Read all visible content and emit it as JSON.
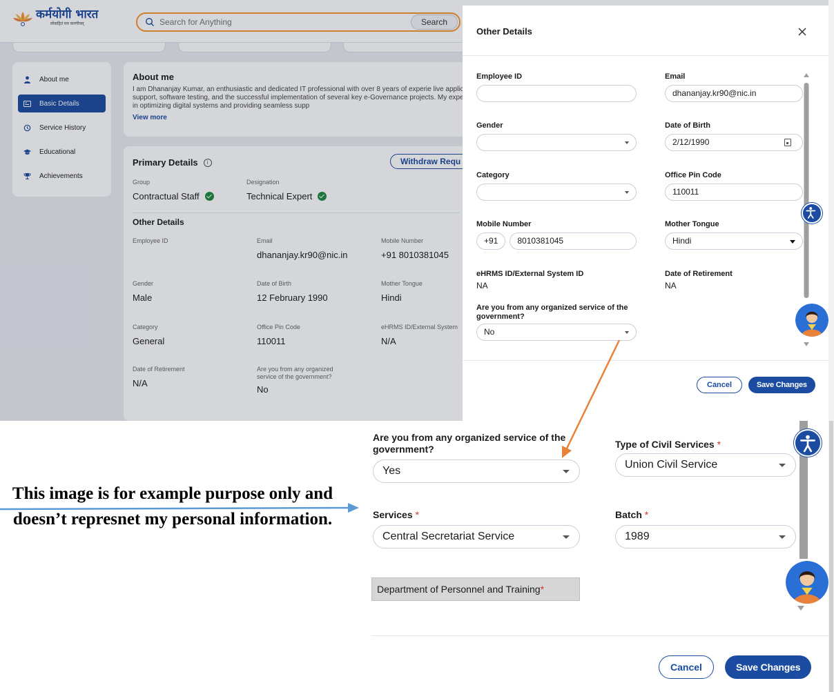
{
  "header": {
    "logo_text": "कर्मयोगी भारत",
    "logo_tagline": "लोकहितं मम करणीयम्",
    "search_placeholder": "Search for Anything",
    "search_button": "Search"
  },
  "sidebar": {
    "items": [
      {
        "label": "About me",
        "icon": "person-icon",
        "active": false
      },
      {
        "label": "Basic Details",
        "icon": "id-card-icon",
        "active": true
      },
      {
        "label": "Service History",
        "icon": "history-icon",
        "active": false
      },
      {
        "label": "Educational",
        "icon": "graduation-cap-icon",
        "active": false
      },
      {
        "label": "Achievements",
        "icon": "trophy-icon",
        "active": false
      }
    ]
  },
  "about": {
    "title": "About me",
    "text": "I am Dhananjay Kumar, an enthusiastic and dedicated IT professional with over 8 years of experie live application support, software testing, and the successful implementation of several key e-Governance projects. My expertise lies in optimizing digital systems and providing seamless supp",
    "view_more": "View more"
  },
  "primary": {
    "title": "Primary Details",
    "withdraw_button": "Withdraw Requ",
    "group_label": "Group",
    "group_value": "Contractual Staff",
    "designation_label": "Designation",
    "designation_value": "Technical Expert",
    "other_title": "Other Details",
    "fields": [
      {
        "label": "Employee ID",
        "value": ""
      },
      {
        "label": "Email",
        "value": "dhananjay.kr90@nic.in"
      },
      {
        "label": "Mobile Number",
        "value": "+91 8010381045"
      },
      {
        "label": "Gender",
        "value": "Male"
      },
      {
        "label": "Date of Birth",
        "value": "12 February 1990"
      },
      {
        "label": "Mother Tongue",
        "value": "Hindi"
      },
      {
        "label": "Category",
        "value": "General"
      },
      {
        "label": "Office Pin Code",
        "value": "110011"
      },
      {
        "label": "eHRMS ID/External System",
        "value": "N/A"
      },
      {
        "label": "Date of Retirement",
        "value": "N/A"
      },
      {
        "label": "Are you from any organized service of the government?",
        "value": "No"
      }
    ]
  },
  "modal": {
    "title": "Other Details",
    "employee_id_label": "Employee ID",
    "employee_id_value": "",
    "email_label": "Email",
    "email_value": "dhananjay.kr90@nic.in",
    "gender_label": "Gender",
    "gender_value": "",
    "dob_label": "Date of Birth",
    "dob_value": "2/12/1990",
    "category_label": "Category",
    "category_value": "",
    "pin_label": "Office Pin Code",
    "pin_value": "110011",
    "mobile_label": "Mobile Number",
    "mobile_prefix": "+91",
    "mobile_value": "8010381045",
    "tongue_label": "Mother Tongue",
    "tongue_value": "Hindi",
    "ehrms_label": "eHRMS ID/External System ID",
    "ehrms_value": "NA",
    "retirement_label": "Date of Retirement",
    "retirement_value": "NA",
    "organized_label": "Are you from any organized service of the government?",
    "organized_value": "No",
    "cancel": "Cancel",
    "save": "Save Changes"
  },
  "zoom": {
    "organized_label": "Are you from any organized service of the government?",
    "organized_value": "Yes",
    "civil_label": "Type of Civil Services",
    "civil_value": "Union Civil Service",
    "services_label": "Services",
    "services_value": "Central Secretariat Service",
    "batch_label": "Batch",
    "batch_value": "1989",
    "department": "Department of Personnel and Training",
    "required_mark": "*",
    "cancel": "Cancel",
    "save": "Save Changes"
  },
  "annotation": {
    "note": "This image is for example purpose only and doesn’t represnet my personal  information."
  },
  "colors": {
    "brand_blue": "#1b4ca1",
    "search_border": "#f3962f",
    "arrow_orange": "#e8823a",
    "arrow_blue": "#5b9bd5",
    "required_red": "#d0312d"
  }
}
